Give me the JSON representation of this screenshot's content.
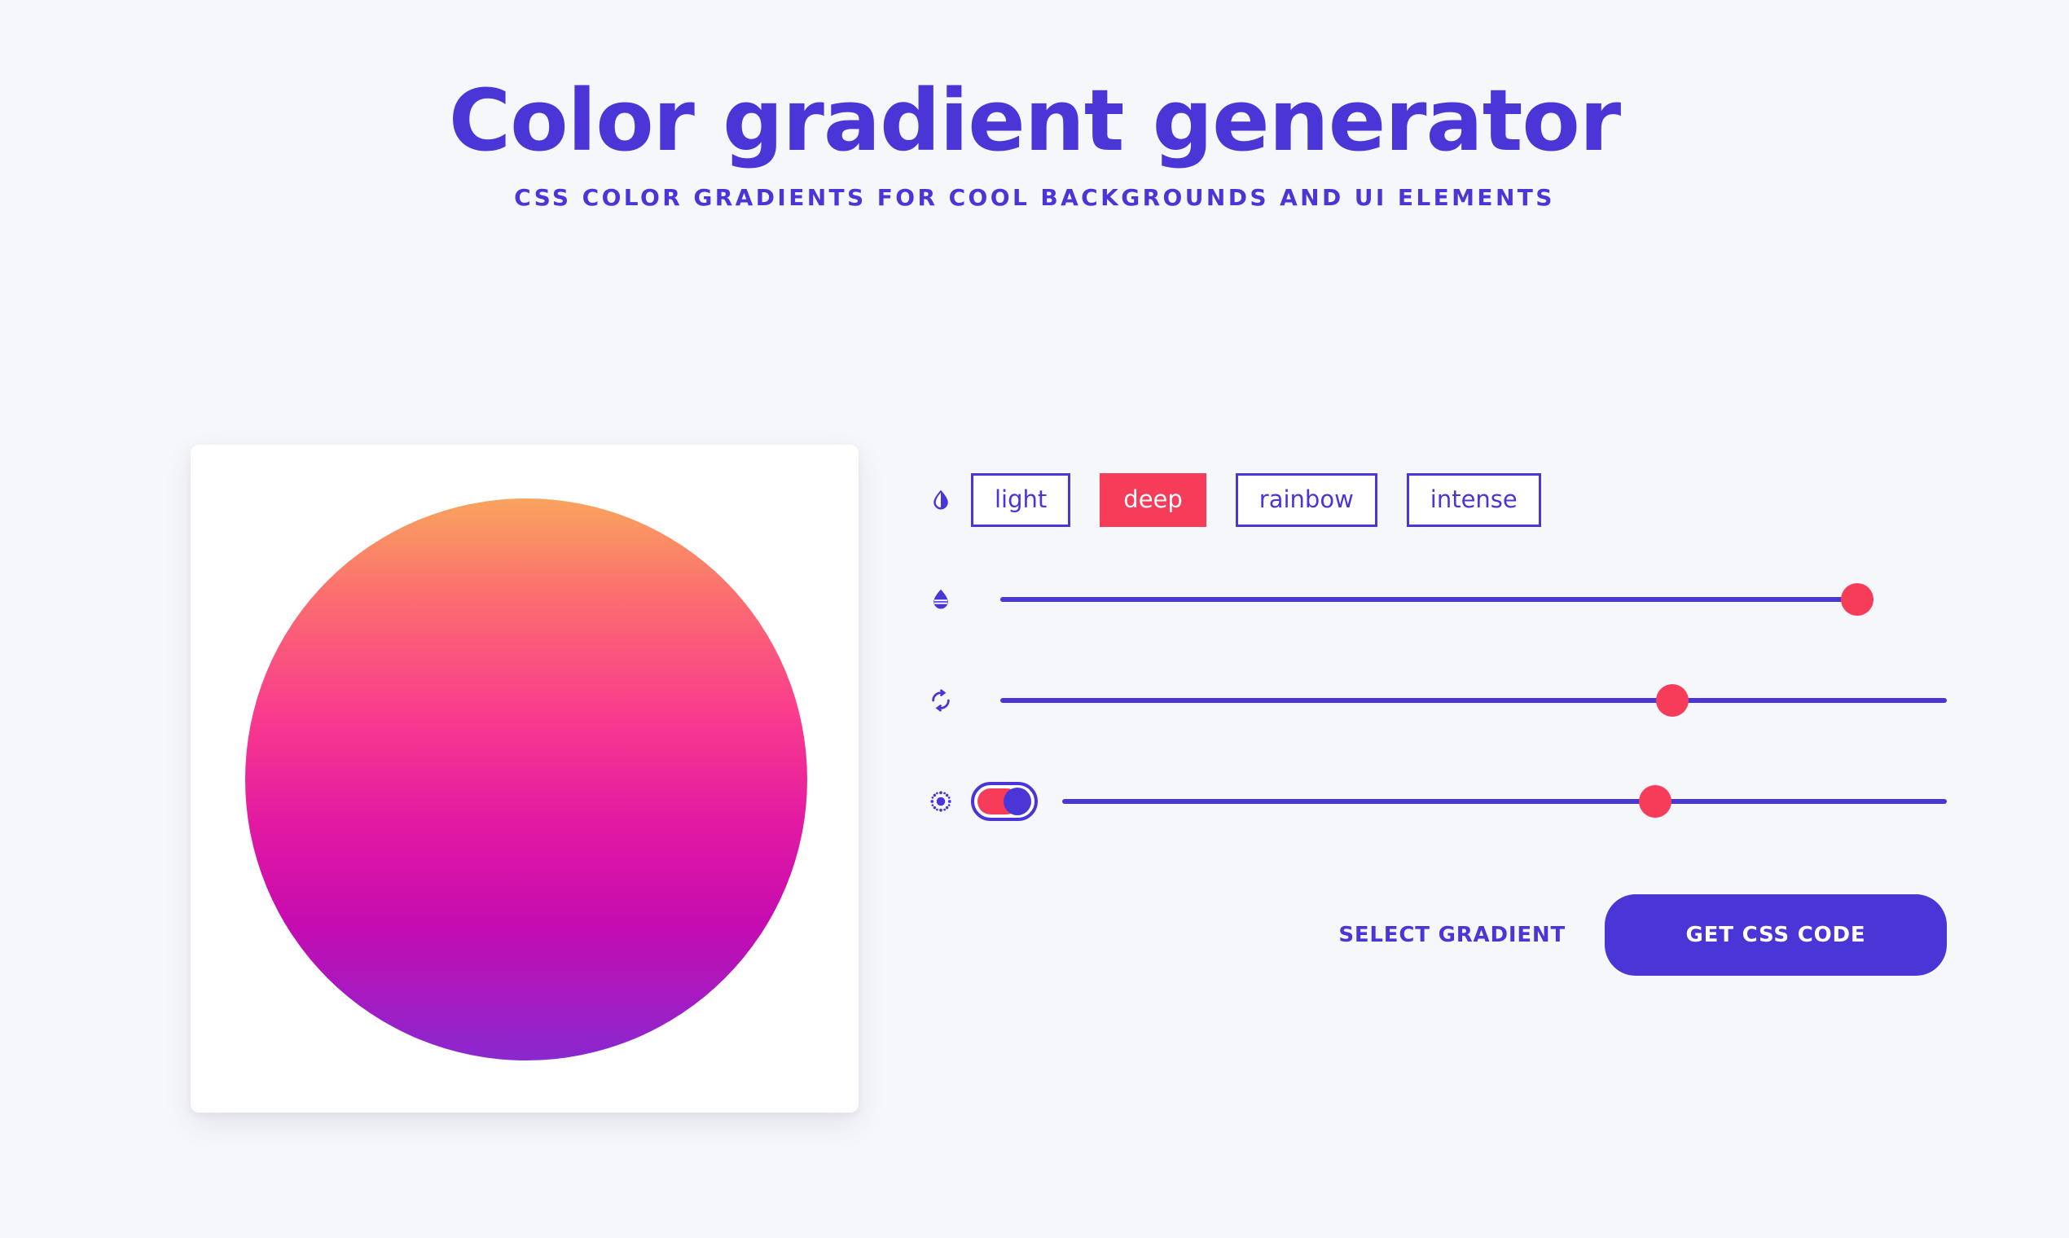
{
  "header": {
    "title": "Color gradient generator",
    "subtitle": "CSS color gradients for cool backgrounds and UI elements"
  },
  "preview": {
    "shape_name": "gradient-sphere",
    "gradient_stops": [
      {
        "color": "#f9a45e",
        "position": "0%"
      },
      {
        "color": "#fb6f6f",
        "position": "17%"
      },
      {
        "color": "#fa3c8c",
        "position": "38%"
      },
      {
        "color": "#e219a3",
        "position": "58%"
      },
      {
        "color": "#c50bb0",
        "position": "76%"
      },
      {
        "color": "#8a28d0",
        "position": "100%"
      }
    ],
    "gradient_direction": "to bottom"
  },
  "controls": {
    "presets": {
      "icon": "contrast-droplet-icon",
      "options": [
        {
          "label": "light",
          "active": false
        },
        {
          "label": "deep",
          "active": true
        },
        {
          "label": "rainbow",
          "active": false
        },
        {
          "label": "intense",
          "active": false
        }
      ]
    },
    "sliders": [
      {
        "icon": "saturation-droplet-icon",
        "name": "saturation-slider",
        "value": 100
      },
      {
        "icon": "rotate-icon",
        "name": "rotation-slider",
        "value": 71
      },
      {
        "icon": "grain-icon",
        "name": "grain-slider",
        "value": 67
      }
    ],
    "toggle": {
      "name": "grain-toggle",
      "state": "on"
    }
  },
  "actions": {
    "select_gradient_label": "Select gradient",
    "get_css_label": "Get CSS code"
  },
  "colors": {
    "accent_blue": "#4a36d6",
    "accent_red": "#f73c5a",
    "page_background": "#f6f7fa",
    "card_background": "#ffffff"
  }
}
